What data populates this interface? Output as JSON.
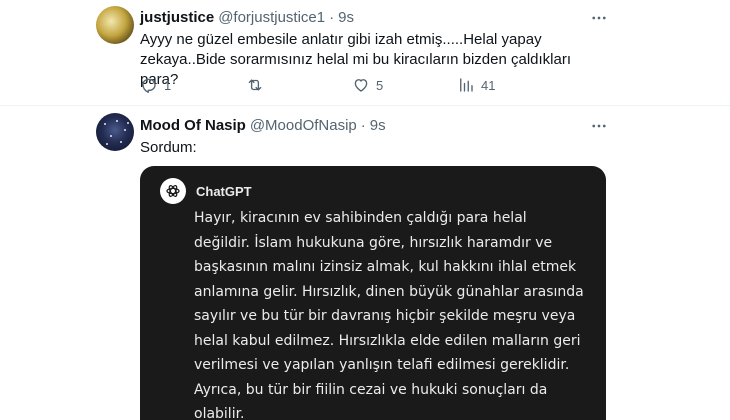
{
  "tweet1": {
    "name": "justjustice",
    "handle": "@forjustjustice1",
    "time": "9s",
    "text": "Ayyy ne güzel embesile anlatır gibi izah etmiş.....Helal yapay zekaya..Bide sorarmısınız helal mi bu kiracıların bizden çaldıkları para?",
    "actions": {
      "reply_count": "1",
      "retweet_count": "",
      "like_count": "5",
      "views_count": "41"
    }
  },
  "tweet2": {
    "name": "Mood Of Nasip",
    "handle": "@MoodOfNasip",
    "time": "9s",
    "text": "Sordum:",
    "embed": {
      "title": "ChatGPT",
      "text": "Hayır, kiracının ev sahibinden çaldığı para helal değildir. İslam hukukuna göre, hırsızlık haramdır ve başkasının malını izinsiz almak, kul hakkını ihlal etmek anlamına gelir. Hırsızlık, dinen büyük günahlar arasında sayılır ve bu tür bir davranış hiçbir şekilde meşru veya helal kabul edilmez. Hırsızlıkla elde edilen malların geri verilmesi ve yapılan yanlışın telafi edilmesi gereklidir. Ayrıca, bu tür bir fiilin cezai ve hukuki sonuçları da olabilir."
    }
  },
  "separator": "·",
  "icons": {
    "more": "more-horizontal-icon",
    "reply": "reply-icon",
    "retweet": "retweet-icon",
    "like": "heart-icon",
    "views": "views-chart-icon",
    "chatgpt": "chatgpt-logo-icon"
  },
  "colors": {
    "text_primary": "#0f1419",
    "text_secondary": "#536471",
    "embed_background": "#1a1a1a",
    "embed_text": "#ececec"
  }
}
